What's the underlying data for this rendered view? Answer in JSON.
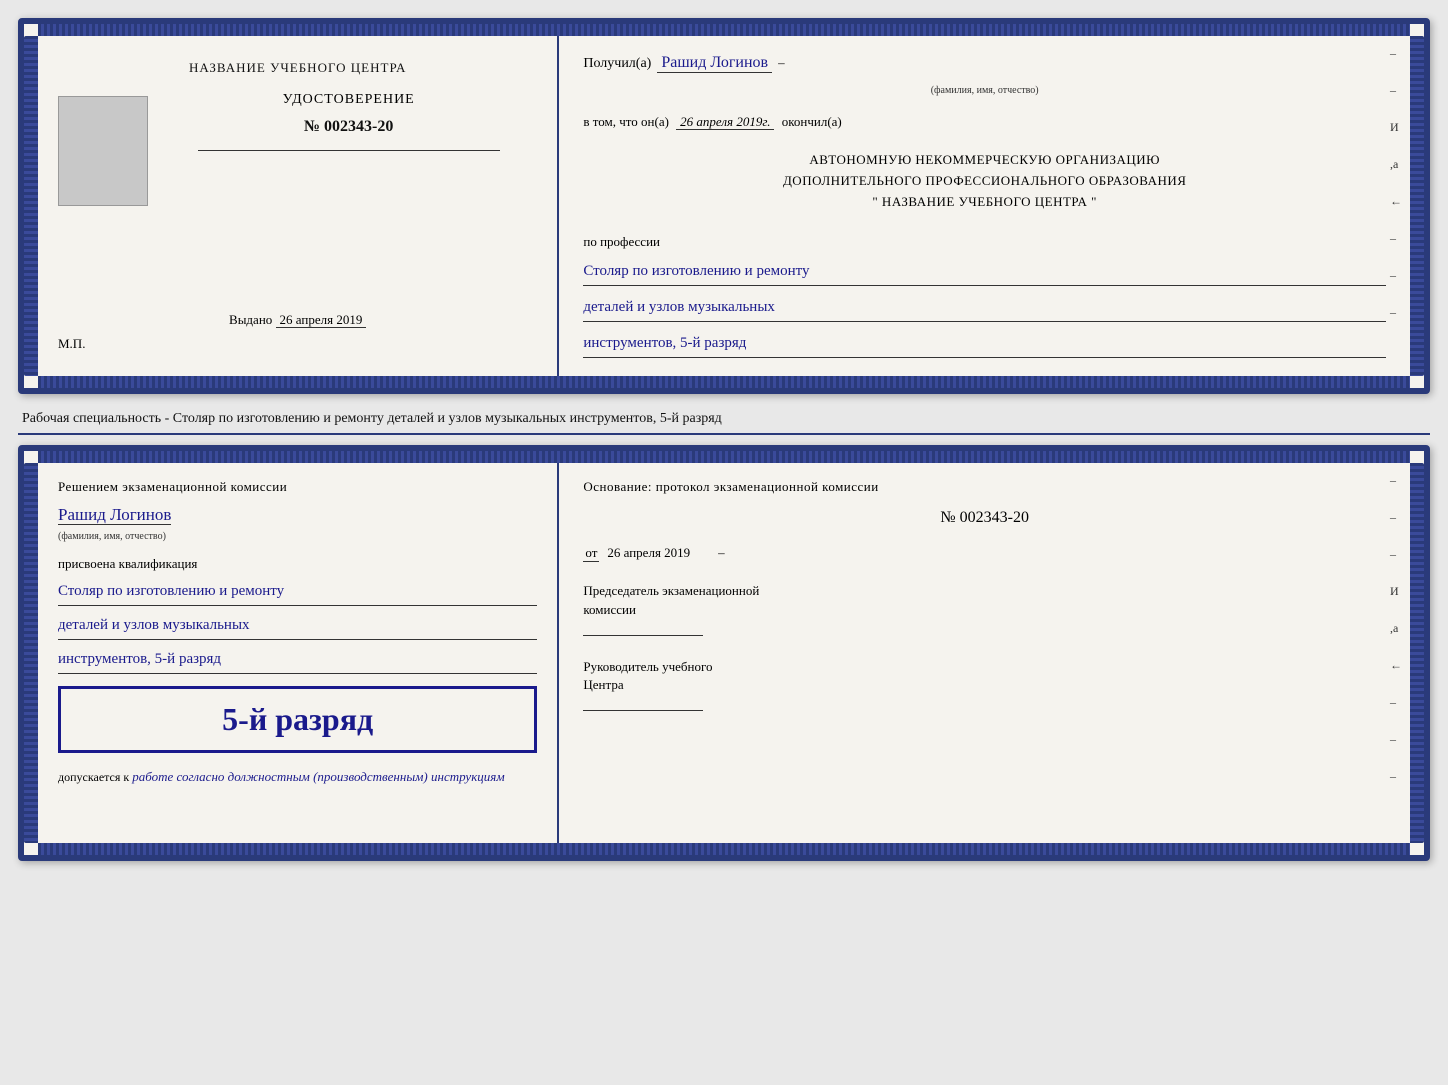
{
  "doc1": {
    "left": {
      "title": "НАЗВАНИЕ УЧЕБНОГО ЦЕНТРА",
      "cert_label": "УДОСТОВЕРЕНИЕ",
      "cert_number": "№ 002343-20",
      "vydano_label": "Выдано",
      "vydano_date": "26 апреля 2019",
      "mp_label": "М.П."
    },
    "right": {
      "poluchil_label": "Получил(а)",
      "person_name": "Рашид Логинов",
      "fio_caption": "(фамилия, имя, отчество)",
      "vtom_label": "в том, что он(а)",
      "date_value": "26 апреля 2019г.",
      "okonchil_label": "окончил(а)",
      "org_line1": "АВТОНОМНУЮ НЕКОММЕРЧЕСКУЮ ОРГАНИЗАЦИЮ",
      "org_line2": "ДОПОЛНИТЕЛЬНОГО ПРОФЕССИОНАЛЬНОГО ОБРАЗОВАНИЯ",
      "org_line3": "\"  НАЗВАНИЕ УЧЕБНОГО ЦЕНТРА  \"",
      "po_professii": "по профессии",
      "profession_line1": "Столяр по изготовлению и ремонту",
      "profession_line2": "деталей и узлов музыкальных",
      "profession_line3": "инструментов, 5-й разряд",
      "dash1": "–",
      "dash2": "–",
      "dash3": "И",
      "dash4": ",а",
      "dash5": "←",
      "dash6": "–",
      "dash7": "–",
      "dash8": "–"
    }
  },
  "specialty_label": "Рабочая специальность - Столяр по изготовлению и ремонту деталей и узлов музыкальных инструментов, 5-й разряд",
  "doc2": {
    "left": {
      "resheniem_line": "Решением  экзаменационной  комиссии",
      "person_name": "Рашид Логинов",
      "fio_caption": "(фамилия, имя, отчество)",
      "prisvoena_label": "присвоена квалификация",
      "qual_line1": "Столяр по изготовлению и ремонту",
      "qual_line2": "деталей и узлов музыкальных",
      "qual_line3": "инструментов, 5-й разряд",
      "big_rank": "5-й разряд",
      "dopuskaetsya_label": "допускается к",
      "dopusk_text": "работе согласно должностным (производственным) инструкциям"
    },
    "right": {
      "osnovanie_line": "Основание: протокол экзаменационной  комиссии",
      "protocol_number": "№  002343-20",
      "ot_label": "от",
      "ot_date": "26 апреля 2019",
      "predsedatel_line1": "Председатель экзаменационной",
      "predsedatel_line2": "комиссии",
      "rukovoditel_line1": "Руководитель учебного",
      "rukovoditel_line2": "Центра",
      "dash1": "–",
      "dash2": "–",
      "dash3": "–",
      "dash4": "И",
      "dash5": ",а",
      "dash6": "←",
      "dash7": "–",
      "dash8": "–",
      "dash9": "–"
    }
  }
}
